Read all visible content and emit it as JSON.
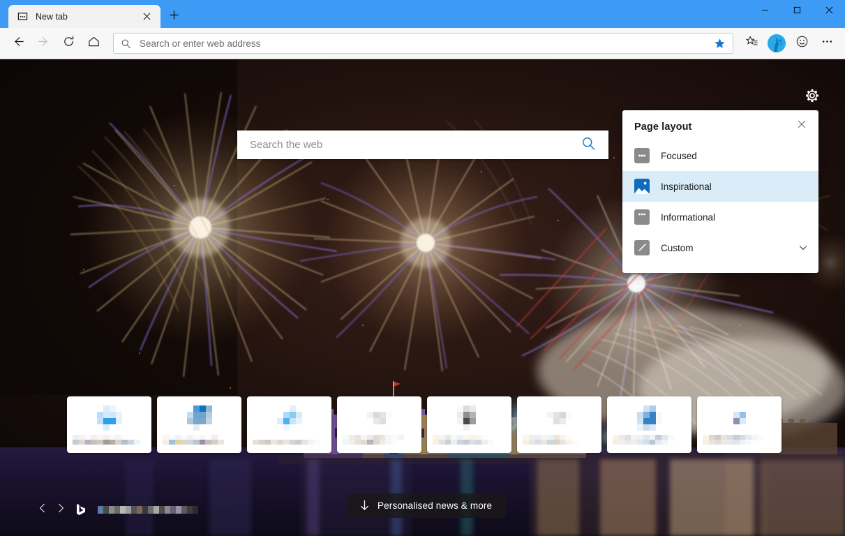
{
  "browser": {
    "tab": {
      "title": "New tab",
      "favicon_icon": "newtab-favicon-icon",
      "close_icon": "close-icon"
    },
    "new_tab_button_icon": "plus-icon",
    "window_controls": {
      "minimize_icon": "minimize-icon",
      "maximize_icon": "maximize-icon",
      "close_icon": "close-icon"
    },
    "toolbar": {
      "back_icon": "back-arrow-icon",
      "forward_icon": "forward-arrow-icon",
      "refresh_icon": "refresh-icon",
      "home_icon": "home-icon",
      "address_placeholder": "Search or enter web address",
      "address_value": "",
      "address_search_icon": "search-icon",
      "favorite_star_icon": "star-filled-icon",
      "favorites_hub_icon": "favorites-star-list-icon",
      "profile_icon": "profile-avatar-icon",
      "feedback_icon": "smiley-face-icon",
      "more_icon": "ellipsis-icon"
    },
    "accent_color": "#3d9bf5",
    "toolbar_bg": "#f7f7f7"
  },
  "newtab": {
    "settings_gear_icon": "gear-icon",
    "search": {
      "placeholder": "Search the web",
      "value": "",
      "search_icon": "search-icon"
    },
    "flyout": {
      "title": "Page layout",
      "close_icon": "close-icon",
      "selected": "Inspirational",
      "highlight_color": "#d9ecf7",
      "options": [
        {
          "label": "Focused",
          "icon": "focused-layout-icon",
          "selected": false,
          "expandable": false
        },
        {
          "label": "Inspirational",
          "icon": "inspirational-image-icon",
          "selected": true,
          "expandable": false
        },
        {
          "label": "Informational",
          "icon": "informational-layout-icon",
          "selected": false,
          "expandable": false
        },
        {
          "label": "Custom",
          "icon": "pencil-edit-icon",
          "selected": false,
          "expandable": true,
          "chevron_icon": "chevron-down-icon"
        }
      ]
    },
    "tiles": [
      {
        "name": "top-site-tile-1",
        "label": "",
        "redacted": true
      },
      {
        "name": "top-site-tile-2",
        "label": "",
        "redacted": true
      },
      {
        "name": "top-site-tile-3",
        "label": "",
        "redacted": true
      },
      {
        "name": "top-site-tile-4",
        "label": "",
        "redacted": true
      },
      {
        "name": "top-site-tile-5",
        "label": "",
        "redacted": true
      },
      {
        "name": "top-site-tile-6",
        "label": "",
        "redacted": true
      },
      {
        "name": "top-site-tile-7",
        "label": "",
        "redacted": true
      },
      {
        "name": "top-site-tile-8",
        "label": "",
        "redacted": true
      }
    ],
    "bottom": {
      "prev_icon": "chevron-left-icon",
      "next_icon": "chevron-right-icon",
      "bing_icon": "bing-logo-icon",
      "caption": "",
      "caption_redacted": true,
      "news_button": {
        "label": "Personalised news & more",
        "icon": "download-arrow-icon",
        "background": "rgba(26,24,25,.82)"
      }
    },
    "background": {
      "description": "Night fireworks display over a castle reflected in water",
      "sky_color": "#150b09",
      "firework_gold": "#e8c79a",
      "firework_purple": "#6f5fc8",
      "water_color": "#1c1433"
    }
  }
}
